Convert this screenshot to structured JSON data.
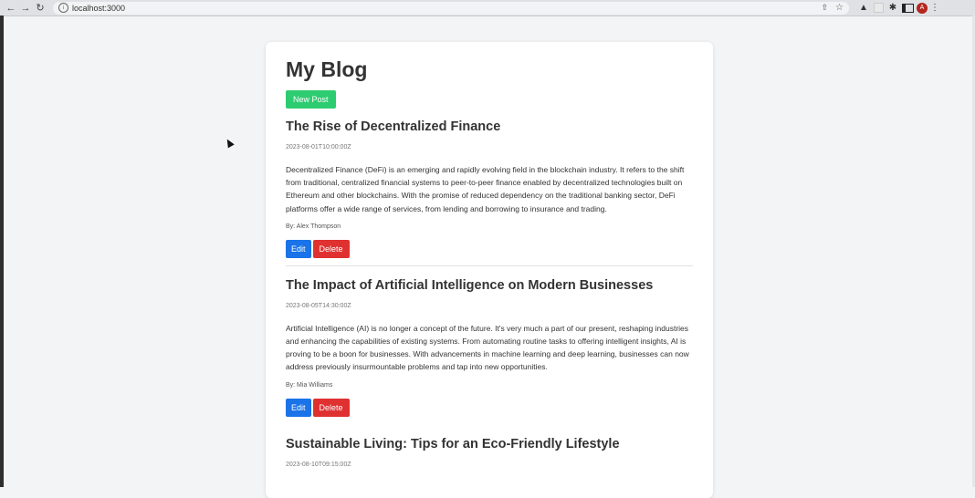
{
  "browser": {
    "url": "localhost:3000",
    "avatar_initial": "A",
    "icons": [
      "back-icon",
      "forward-icon",
      "reload-icon",
      "info-icon",
      "share-icon",
      "star-icon",
      "extension-icon",
      "puzzle-icon",
      "side-panel-icon",
      "menu-icon"
    ]
  },
  "page": {
    "title": "My Blog",
    "new_post_label": "New Post"
  },
  "posts": [
    {
      "title": "The Rise of Decentralized Finance",
      "date": "2023-08-01T10:00:00Z",
      "body": "Decentralized Finance (DeFi) is an emerging and rapidly evolving field in the blockchain industry. It refers to the shift from traditional, centralized financial systems to peer-to-peer finance enabled by decentralized technologies built on Ethereum and other blockchains. With the promise of reduced dependency on the traditional banking sector, DeFi platforms offer a wide range of services, from lending and borrowing to insurance and trading.",
      "author": "By: Alex Thompson",
      "edit_label": "Edit",
      "delete_label": "Delete"
    },
    {
      "title": "The Impact of Artificial Intelligence on Modern Businesses",
      "date": "2023-08-05T14:30:00Z",
      "body": "Artificial Intelligence (AI) is no longer a concept of the future. It's very much a part of our present, reshaping industries and enhancing the capabilities of existing systems. From automating routine tasks to offering intelligent insights, AI is proving to be a boon for businesses. With advancements in machine learning and deep learning, businesses can now address previously insurmountable problems and tap into new opportunities.",
      "author": "By: Mia Williams",
      "edit_label": "Edit",
      "delete_label": "Delete"
    },
    {
      "title": "Sustainable Living: Tips for an Eco-Friendly Lifestyle",
      "date": "2023-08-10T09:15:00Z"
    }
  ],
  "colors": {
    "new_post": "#2ecc71",
    "edit": "#1a73e8",
    "delete": "#e03131"
  }
}
